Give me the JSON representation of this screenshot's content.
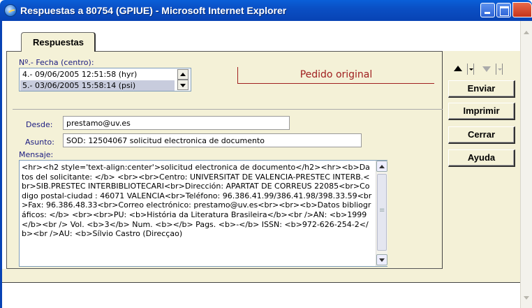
{
  "window": {
    "title": "Respuestas a 80754 (GPIUE) - Microsoft Internet Explorer"
  },
  "tabs": [
    {
      "label": "Respuestas",
      "active": true
    }
  ],
  "form": {
    "fecha_label": "Nº.- Fecha (centro):",
    "fecha_options": [
      {
        "label": "4.- 09/06/2005 12:51:58 (hyr)",
        "selected": false
      },
      {
        "label": "5.- 03/06/2005 15:58:14 (psi)",
        "selected": true
      }
    ],
    "pedido_original": "Pedido original",
    "desde_label": "Desde:",
    "desde_value": "prestamo@uv.es",
    "asunto_label": "Asunto:",
    "asunto_value": "SOD: 12504067 solicitud electronica de documento",
    "mensaje_label": "Mensaje:",
    "mensaje_value": "<hr><h2 style='text-align:center'>solicitud electronica de documento</h2><hr><b>Datos del solicitante: </b> <br><br>Centro: UNIVERSITAT DE VALENCIA-PRESTEC INTERB.<br>SIB.PRESTEC INTERBIBLIOTECARI<br>Dirección: APARTAT DE CORREUS 22085<br>Codigo postal-ciudad : 46071 VALENCIA<br>Teléfono: 96.386.41.99/386.41.98/398.33.59<br>Fax: 96.386.48.33<br>Correo electrónico: prestamo@uv.es<br><br><b>Datos bibliográficos: </b> <br><br>PU: <b>História da Literatura Brasileira</b><br />AN: <b>1999</b><br /> Vol. <b>3</b> Num. <b></b> Pags. <b>-</b> ISSN: <b>972-626-254-2</b><br />AU: <b>Sílvio Castro (Direcçao)"
  },
  "actions": {
    "enviar": "Enviar",
    "imprimir": "Imprimir",
    "cerrar": "Cerrar",
    "ayuda": "Ayuda"
  },
  "colors": {
    "panel_bg": "#f4f1d7",
    "title_bar": "#0a5fd8",
    "accent_red": "#a02020"
  }
}
